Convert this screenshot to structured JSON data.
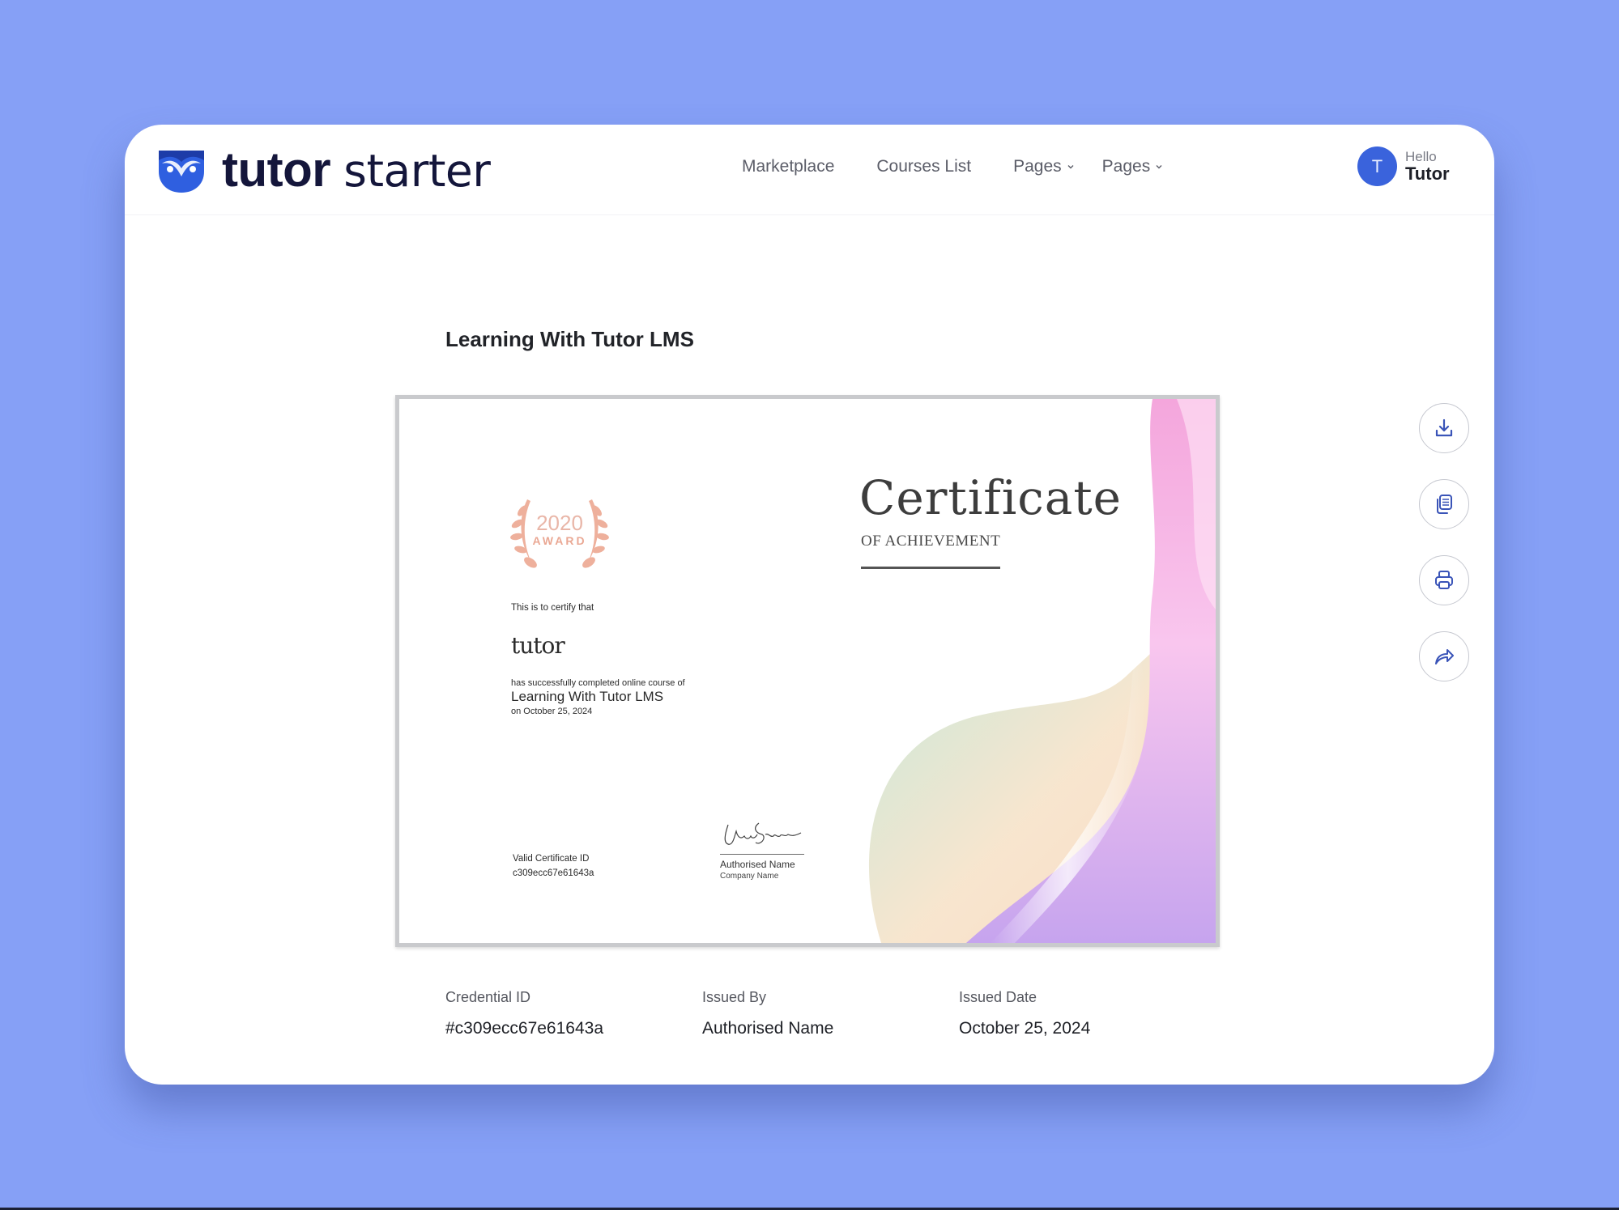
{
  "brand": {
    "name_bold": "tutor",
    "name_light": "starter",
    "logo_icon": "owl-logo-icon",
    "primary_color": "#2f5fe0",
    "dark_color": "#14163b"
  },
  "nav": {
    "items": [
      {
        "label": "Marketplace",
        "dropdown": false
      },
      {
        "label": "Courses List",
        "dropdown": false
      },
      {
        "label": "Pages",
        "dropdown": true
      },
      {
        "label": "Pages",
        "dropdown": true
      }
    ]
  },
  "user": {
    "avatar_initial": "T",
    "greeting": "Hello",
    "name": "Tutor",
    "avatar_color": "#3a63dc"
  },
  "page": {
    "course_title": "Learning With Tutor LMS",
    "background_color": "#86a0f6"
  },
  "certificate": {
    "award_year": "2020",
    "award_label": "AWARD",
    "certify_text": "This is to certify that",
    "recipient": "tutor",
    "completed_text": "has successfully completed online course of",
    "course": "Learning With Tutor LMS",
    "date_text": "on October 25, 2024",
    "valid_id_label": "Valid Certificate ID",
    "valid_id": "c309ecc67e61643a",
    "signatory_name": "Authorised Name",
    "signatory_company": "Company Name",
    "title": "Certificate",
    "subtitle": "OF ACHIEVEMENT"
  },
  "actions": [
    {
      "name": "download",
      "icon": "download-icon"
    },
    {
      "name": "copy",
      "icon": "copy-document-icon"
    },
    {
      "name": "print",
      "icon": "printer-icon"
    },
    {
      "name": "share",
      "icon": "share-arrow-icon"
    }
  ],
  "meta": [
    {
      "label": "Credential ID",
      "value": "#c309ecc67e61643a"
    },
    {
      "label": "Issued By",
      "value": "Authorised Name"
    },
    {
      "label": "Issued Date",
      "value": "October 25, 2024"
    }
  ]
}
